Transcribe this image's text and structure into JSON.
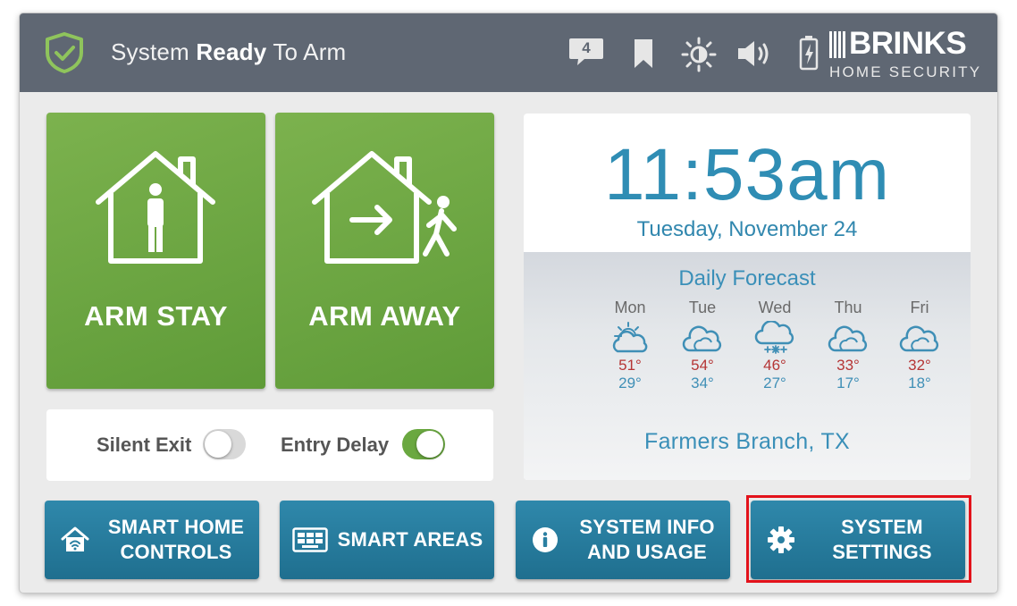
{
  "status": {
    "prefix": "System ",
    "bold": "Ready",
    "suffix": " To Arm"
  },
  "top_icons": {
    "message_count": "4"
  },
  "brand": {
    "name": "BRINKS",
    "sub": "HOME SECURITY"
  },
  "arm": {
    "stay_label": "ARM STAY",
    "away_label": "ARM AWAY"
  },
  "toggles": {
    "silent_exit": {
      "label": "Silent Exit",
      "state": "off"
    },
    "entry_delay": {
      "label": "Entry Delay",
      "state": "on"
    }
  },
  "clock": {
    "time": "11:53am",
    "date": "Tuesday, November 24"
  },
  "forecast": {
    "title": "Daily Forecast",
    "days": [
      {
        "day": "Mon",
        "icon": "partly-cloudy-icon",
        "hi": "51°",
        "lo": "29°"
      },
      {
        "day": "Tue",
        "icon": "cloudy-icon",
        "hi": "54°",
        "lo": "34°"
      },
      {
        "day": "Wed",
        "icon": "snow-icon",
        "hi": "46°",
        "lo": "27°"
      },
      {
        "day": "Thu",
        "icon": "cloudy-icon",
        "hi": "33°",
        "lo": "17°"
      },
      {
        "day": "Fri",
        "icon": "cloudy-icon",
        "hi": "32°",
        "lo": "18°"
      }
    ],
    "location": "Farmers Branch, TX"
  },
  "nav": {
    "smart_home": {
      "line1": "SMART HOME",
      "line2": "CONTROLS"
    },
    "smart_areas": {
      "line1": "SMART AREAS"
    },
    "system_info": {
      "line1": "SYSTEM INFO",
      "line2": "AND USAGE"
    },
    "system_settings": {
      "line1": "SYSTEM",
      "line2": "SETTINGS"
    }
  },
  "colors": {
    "arm_green": "#6aa840",
    "nav_blue": "#2a7fa1",
    "header_gray": "#5f6773",
    "highlight_red": "#e3121b"
  }
}
